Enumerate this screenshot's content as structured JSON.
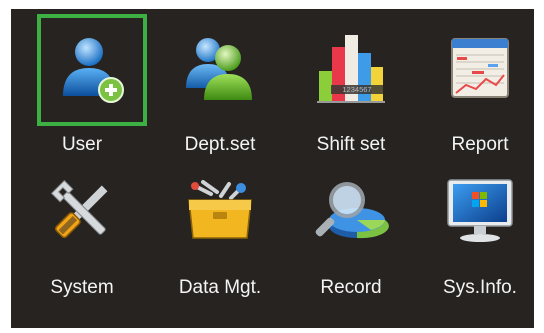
{
  "menu": {
    "items": [
      {
        "label": "User",
        "icon": "user-add-icon",
        "selected": true
      },
      {
        "label": "Dept.set",
        "icon": "department-icon",
        "selected": false
      },
      {
        "label": "Shift set",
        "icon": "bar-chart-icon",
        "selected": false
      },
      {
        "label": "Report",
        "icon": "report-icon",
        "selected": false
      },
      {
        "label": "System",
        "icon": "tools-icon",
        "selected": false
      },
      {
        "label": "Data Mgt.",
        "icon": "toolbox-icon",
        "selected": false
      },
      {
        "label": "Record",
        "icon": "magnifier-pie-icon",
        "selected": false
      },
      {
        "label": "Sys.Info.",
        "icon": "monitor-icon",
        "selected": false
      }
    ],
    "shift_chart_digits": "1234567"
  },
  "colors": {
    "background": "#262321",
    "selection_border": "#3cb043",
    "label_text": "#f4f4f4"
  }
}
